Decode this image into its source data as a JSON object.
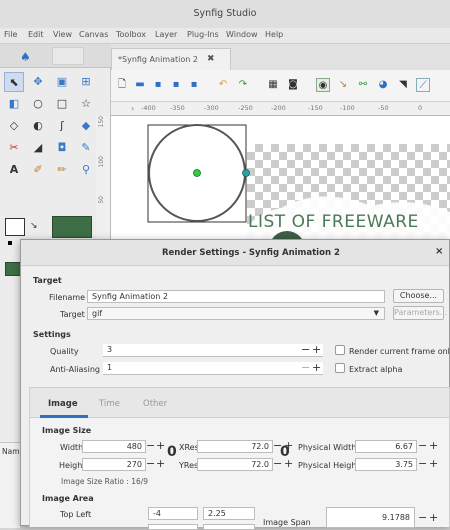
{
  "app": {
    "title": "Synfig Studio"
  },
  "menu": [
    "File",
    "Edit",
    "View",
    "Canvas",
    "Toolbox",
    "Layer",
    "Plug-Ins",
    "Window",
    "Help"
  ],
  "document": {
    "tab_title": "*Synfig Animation 2",
    "close_glyph": "✖",
    "ruler_marks": [
      "-400",
      "-350",
      "-300",
      "-250",
      "-200",
      "-150",
      "-100",
      "-50",
      "0"
    ],
    "vruler_marks": [
      "100",
      "150",
      "50"
    ],
    "watermark": "LIST OF FREEWARE"
  },
  "left_panel": {
    "params_header": "Nam"
  },
  "dialog": {
    "title": "Render Settings - Synfig Animation 2",
    "close_glyph": "×",
    "target_section": "Target",
    "filename_label": "Filename",
    "filename_value": "Synfig Animation 2",
    "choose_button": "Choose...",
    "target_label": "Target",
    "target_value": "gif",
    "parameters_button": "Parameters...",
    "settings_section": "Settings",
    "quality_label": "Quality",
    "quality_value": "3",
    "render_current_label": "Render current frame only",
    "antialias_label": "Anti-Aliasing",
    "antialias_value": "1",
    "extract_alpha_label": "Extract alpha",
    "tabs": [
      "Image",
      "Time",
      "Other"
    ],
    "image_size_section": "Image Size",
    "width_label": "Width",
    "width_value": "480",
    "height_label": "Height",
    "height_value": "270",
    "xres_label": "XRes",
    "xres_value": "72.0",
    "yres_label": "YRes",
    "yres_value": "72.0",
    "phys_width_label": "Physical Width",
    "phys_width_value": "6.67",
    "phys_height_label": "Physical Height",
    "phys_height_value": "3.75",
    "ratio_text": "Image Size Ratio : 16/9",
    "image_area_section": "Image Area",
    "top_left_label": "Top Left",
    "top_left_x": "-4",
    "top_left_y": "2.25",
    "image_span_label": "Image Span",
    "image_span_value": "9.1788"
  }
}
